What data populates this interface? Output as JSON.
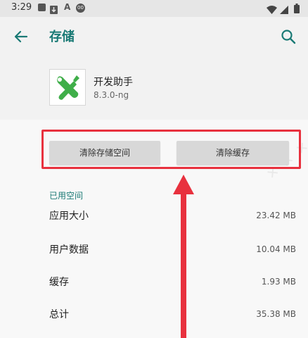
{
  "status_bar": {
    "time": "3:29",
    "icons": [
      "image-icon",
      "download-icon",
      "a-icon",
      "circle-badge-icon",
      "wifi-icon",
      "signal-icon",
      "battery-icon"
    ],
    "circle_badge_text": "00"
  },
  "app_bar": {
    "title": "存储",
    "back_icon": "arrow-back-icon",
    "search_icon": "search-icon",
    "accent_color": "#1a7a75"
  },
  "app": {
    "name": "开发助手",
    "version": "8.3.0-ng",
    "icon": "wrench-screwdriver-icon"
  },
  "actions": {
    "clear_storage": "清除存储空间",
    "clear_cache": "清除缓存",
    "highlight_color": "#e8313e"
  },
  "used_space": {
    "header": "已用空间",
    "rows": [
      {
        "label": "应用大小",
        "value": "23.42 MB"
      },
      {
        "label": "用户数据",
        "value": "10.04 MB"
      },
      {
        "label": "缓存",
        "value": "1.93 MB"
      },
      {
        "label": "总计",
        "value": "35.38 MB"
      }
    ]
  }
}
